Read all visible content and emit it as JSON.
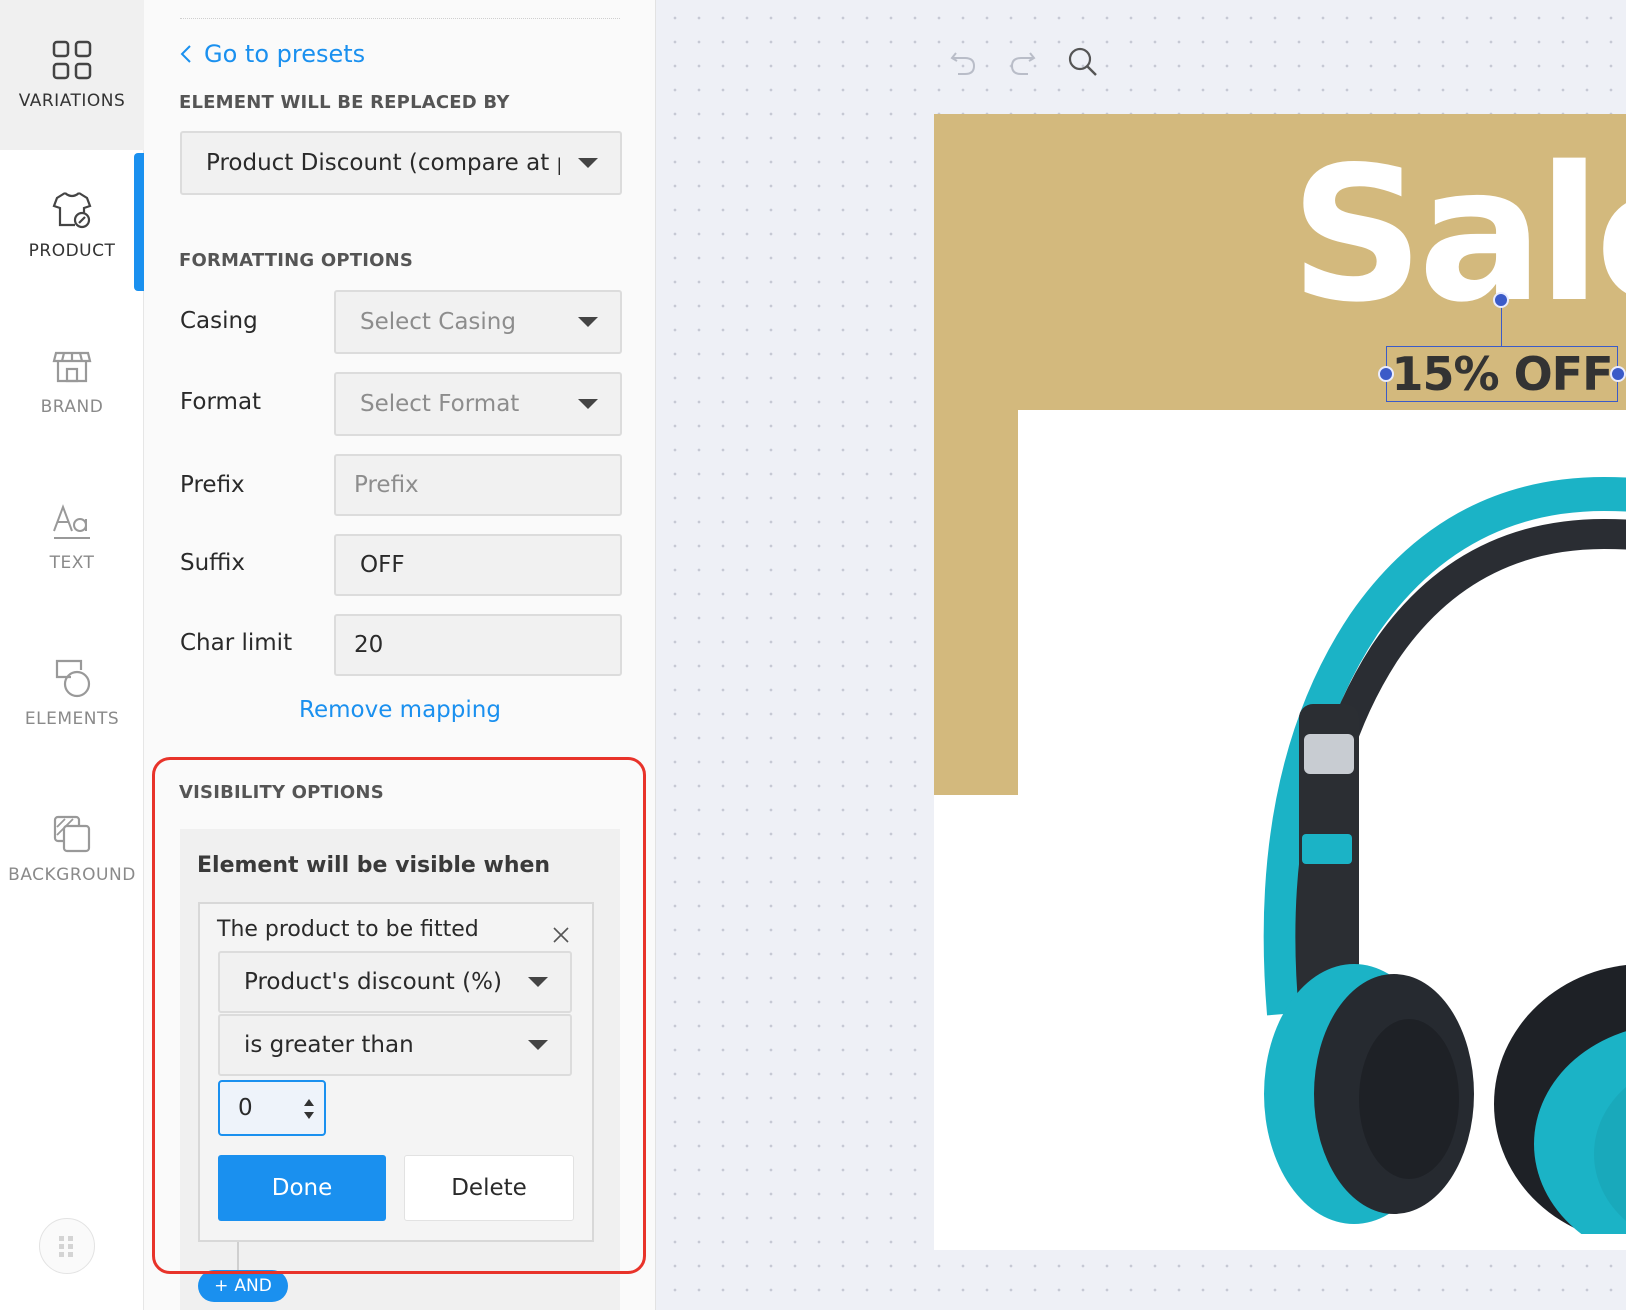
{
  "rail": {
    "items": [
      {
        "label": "VARIATIONS",
        "icon": "grid-icon"
      },
      {
        "label": "PRODUCT",
        "icon": "tshirt-icon"
      },
      {
        "label": "BRAND",
        "icon": "store-icon"
      },
      {
        "label": "TEXT",
        "icon": "text-aa-icon"
      },
      {
        "label": "ELEMENTS",
        "icon": "shapes-icon"
      },
      {
        "label": "BACKGROUND",
        "icon": "layers-icon"
      }
    ],
    "active": "PRODUCT"
  },
  "panel": {
    "back_link": "Go to presets",
    "replaced_by": {
      "title": "ELEMENT WILL BE REPLACED BY",
      "value": "Product Discount (compare at price)"
    },
    "formatting": {
      "title": "FORMATTING OPTIONS",
      "casing_label": "Casing",
      "casing_placeholder": "Select Casing",
      "format_label": "Format",
      "format_placeholder": "Select Format",
      "prefix_label": "Prefix",
      "prefix_placeholder": "Prefix",
      "suffix_label": "Suffix",
      "suffix_value": "OFF",
      "charlimit_label": "Char limit",
      "charlimit_value": "20"
    },
    "remove_mapping": "Remove mapping",
    "visibility": {
      "title": "VISIBILITY OPTIONS",
      "subtitle": "Element will be visible when",
      "condition": {
        "title": "The product to be fitted",
        "field": "Product's discount (%)",
        "operator": "is greater than",
        "value": "0"
      },
      "done_label": "Done",
      "delete_label": "Delete",
      "and_label": "AND"
    }
  },
  "canvas": {
    "headline": "Sale",
    "badge": "15% OFF"
  },
  "colors": {
    "accent": "#1a90ef",
    "gold": "#d3b97d",
    "highlight": "#e8332a",
    "selection": "#3b5bc8",
    "headphone_teal": "#1bb3c6"
  }
}
